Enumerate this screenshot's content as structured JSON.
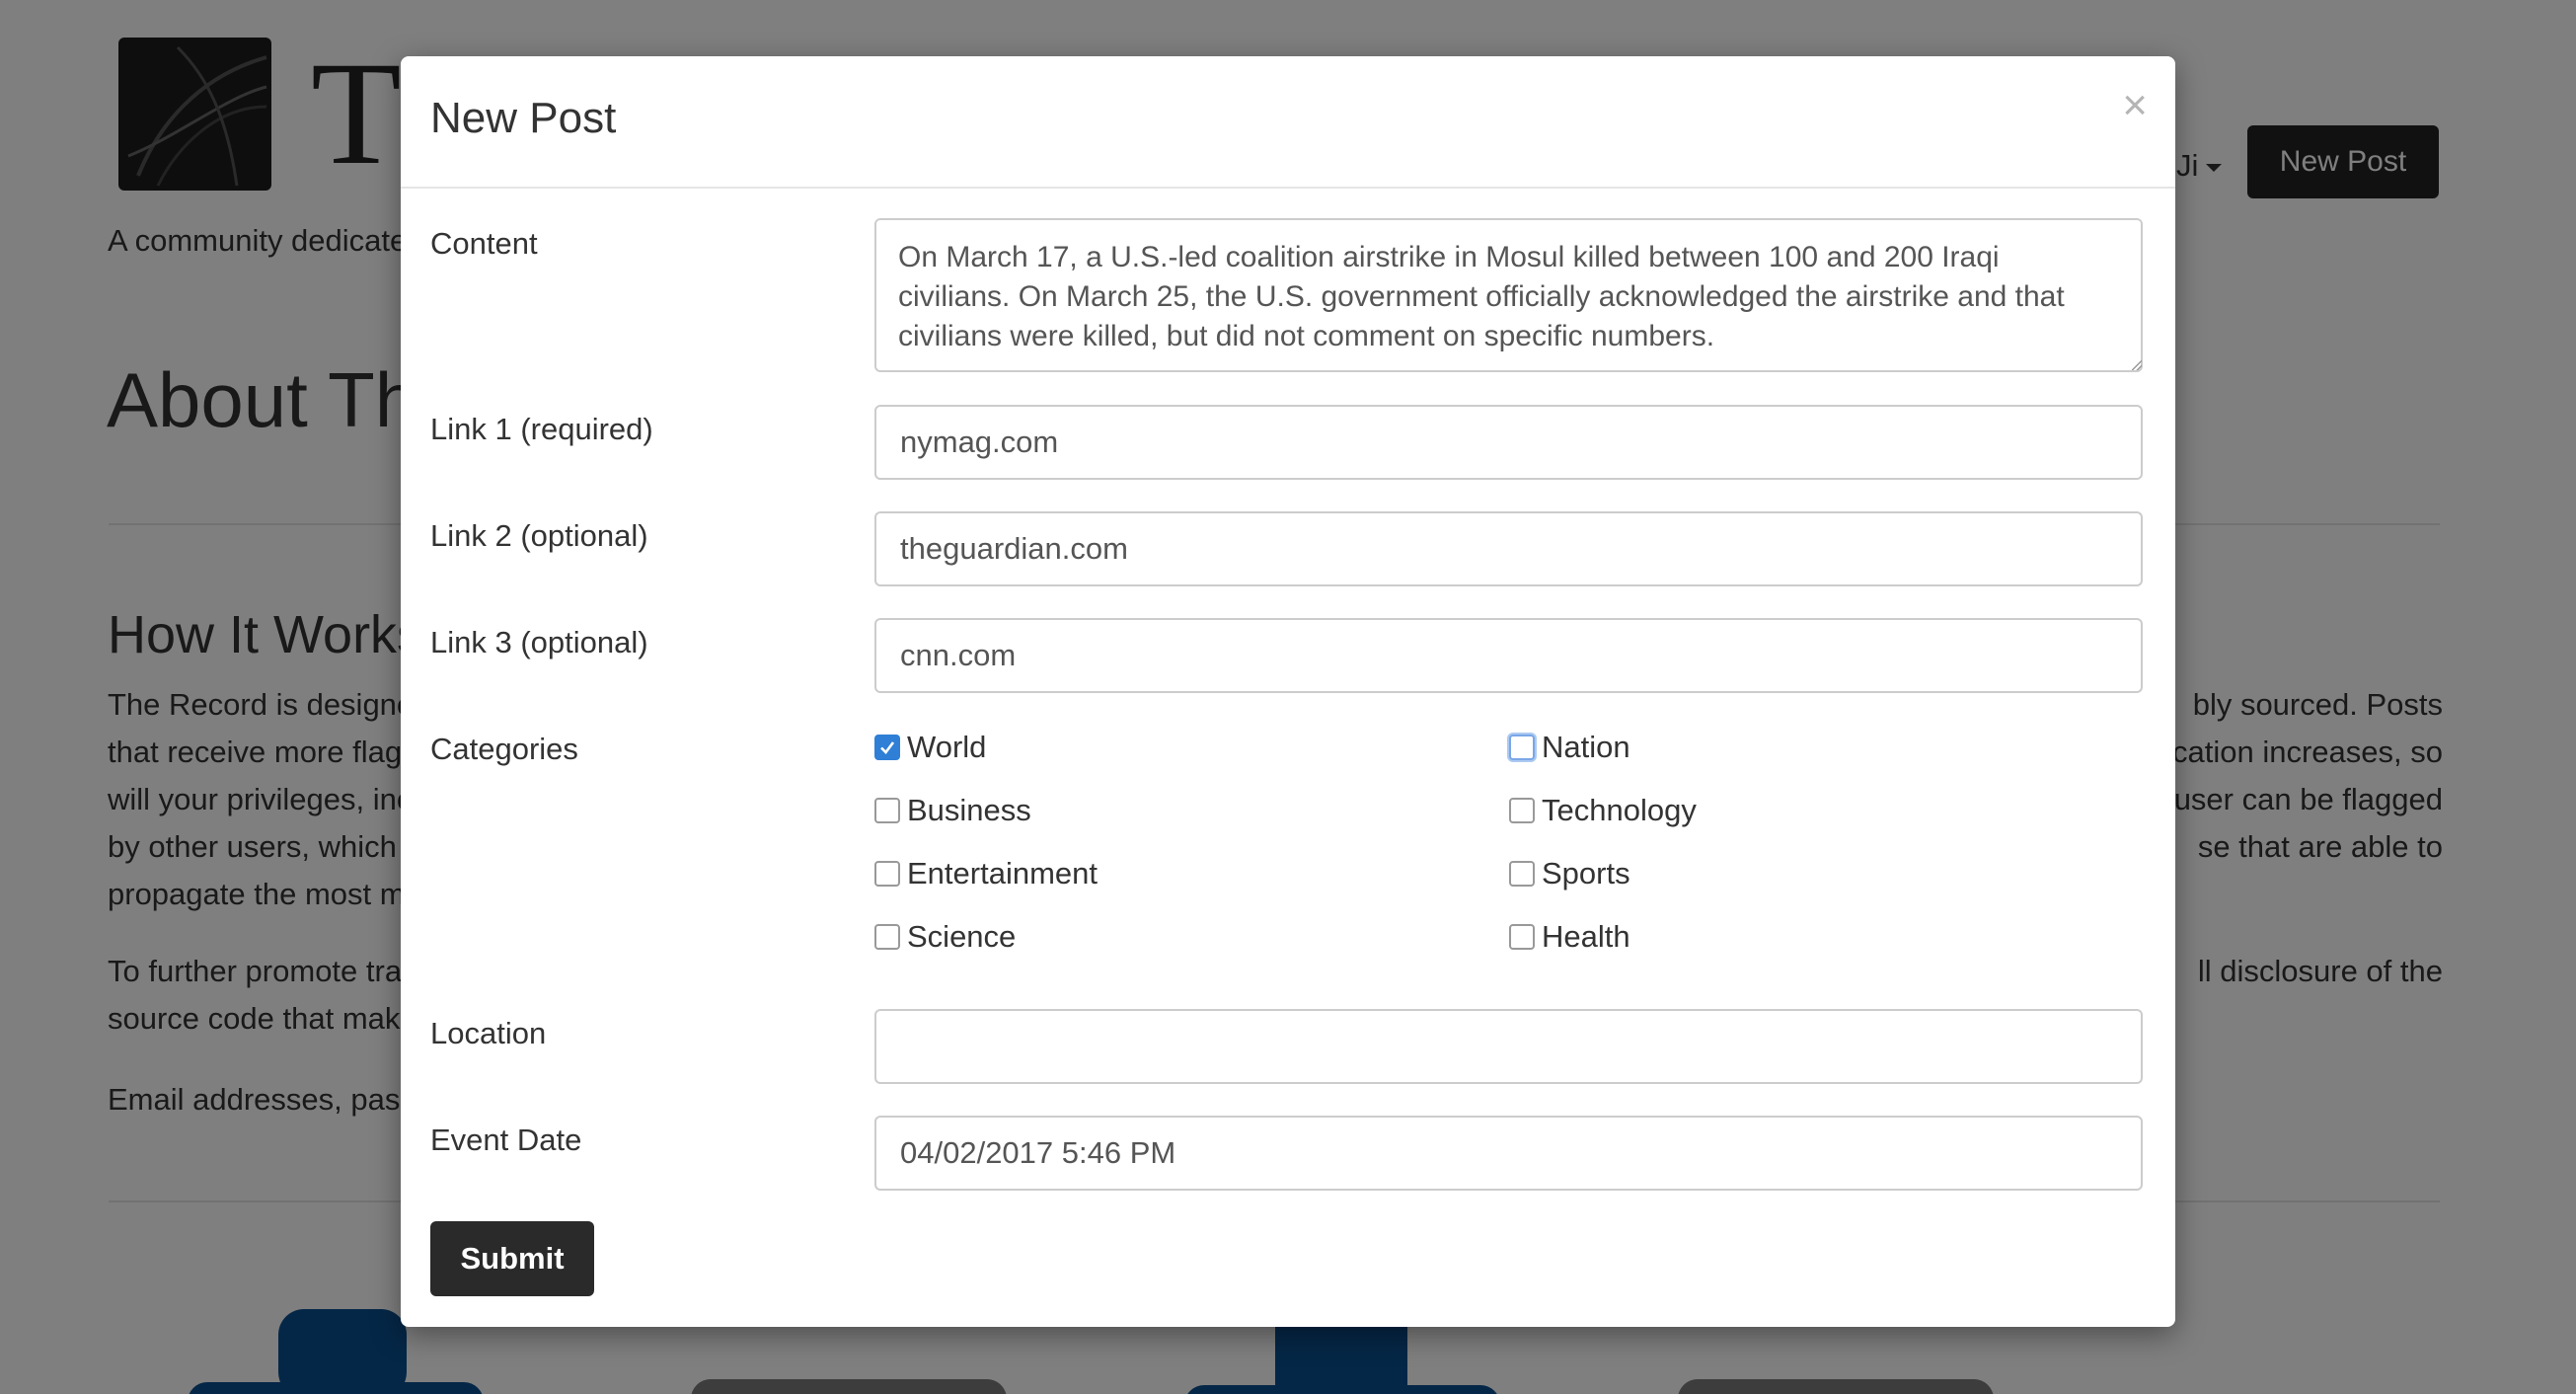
{
  "background": {
    "logo_letter": "T",
    "tagline": "A community dedicate",
    "user_name": "Ji",
    "new_post_button": "New Post",
    "about_heading": "About Th",
    "how_heading": "How It Works",
    "para1_left": [
      "The Record is designed",
      "that receive more flags",
      "will your privileges, inc",
      "by other users, which v",
      "propagate the most m"
    ],
    "para1_right": [
      "bly sourced. Posts",
      "cation increases, so",
      "user can be flagged",
      "se that are able to"
    ],
    "para2_left": [
      "To further promote tra",
      "source code that make"
    ],
    "para2_right": [
      "ll disclosure of the"
    ],
    "para3_left": "Email addresses, passv"
  },
  "modal": {
    "title": "New Post",
    "close_glyph": "×",
    "labels": {
      "content": "Content",
      "link1": "Link 1 (required)",
      "link2": "Link 2 (optional)",
      "link3": "Link 3 (optional)",
      "categories": "Categories",
      "location": "Location",
      "event_date": "Event Date"
    },
    "values": {
      "content": "On March 17, a U.S.-led coalition airstrike in Mosul killed between 100 and 200 Iraqi civilians. On March 25, the U.S. government officially acknowledged the airstrike and that civilians were killed, but did not comment on specific numbers.",
      "link1": "nymag.com",
      "link2": "theguardian.com",
      "link3": "cnn.com",
      "location": "",
      "event_date": "04/02/2017 5:46 PM"
    },
    "categories": [
      {
        "label": "World",
        "checked": true
      },
      {
        "label": "Nation",
        "checked": false
      },
      {
        "label": "Business",
        "checked": false
      },
      {
        "label": "Technology",
        "checked": false
      },
      {
        "label": "Entertainment",
        "checked": false
      },
      {
        "label": "Sports",
        "checked": false
      },
      {
        "label": "Science",
        "checked": false
      },
      {
        "label": "Health",
        "checked": false
      }
    ],
    "submit_label": "Submit"
  },
  "colors": {
    "primary_dark": "#222222",
    "checkbox_checked": "#2f7fd6",
    "brand_blue": "#0a4e8f"
  },
  "icons": {
    "close": "close-icon",
    "check": "checkmark-icon",
    "caret": "caret-down-icon"
  }
}
